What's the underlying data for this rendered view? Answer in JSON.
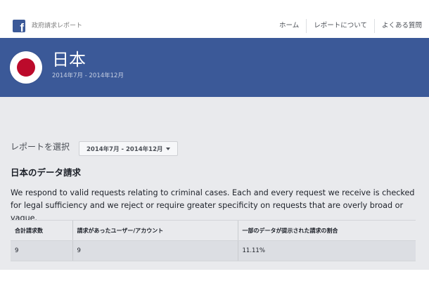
{
  "topnav": {
    "app_title": "政府請求レポート",
    "links": [
      {
        "label": "ホーム"
      },
      {
        "label": "レポートについて"
      },
      {
        "label": "よくある質問"
      }
    ]
  },
  "banner": {
    "country": "日本",
    "period": "2014年7月 - 2014年12月"
  },
  "report_select": {
    "label": "レポートを選択",
    "selected": "2014年7月 - 2014年12月"
  },
  "section": {
    "title": "日本のデータ請求",
    "description": "We respond to valid requests relating to criminal cases. Each and every request we receive is checked for legal sufficiency and we reject or require greater specificity on requests that are overly broad or vague."
  },
  "table": {
    "headers": [
      "合計請求数",
      "請求があったユーザー/アカウント",
      "一部のデータが提示された請求の割合"
    ],
    "rows": [
      [
        "9",
        "9",
        "11.11%"
      ]
    ]
  },
  "colors": {
    "brand": "#3b5998",
    "flag_red": "#bc0a2b",
    "content_bg": "#e9eaed"
  }
}
